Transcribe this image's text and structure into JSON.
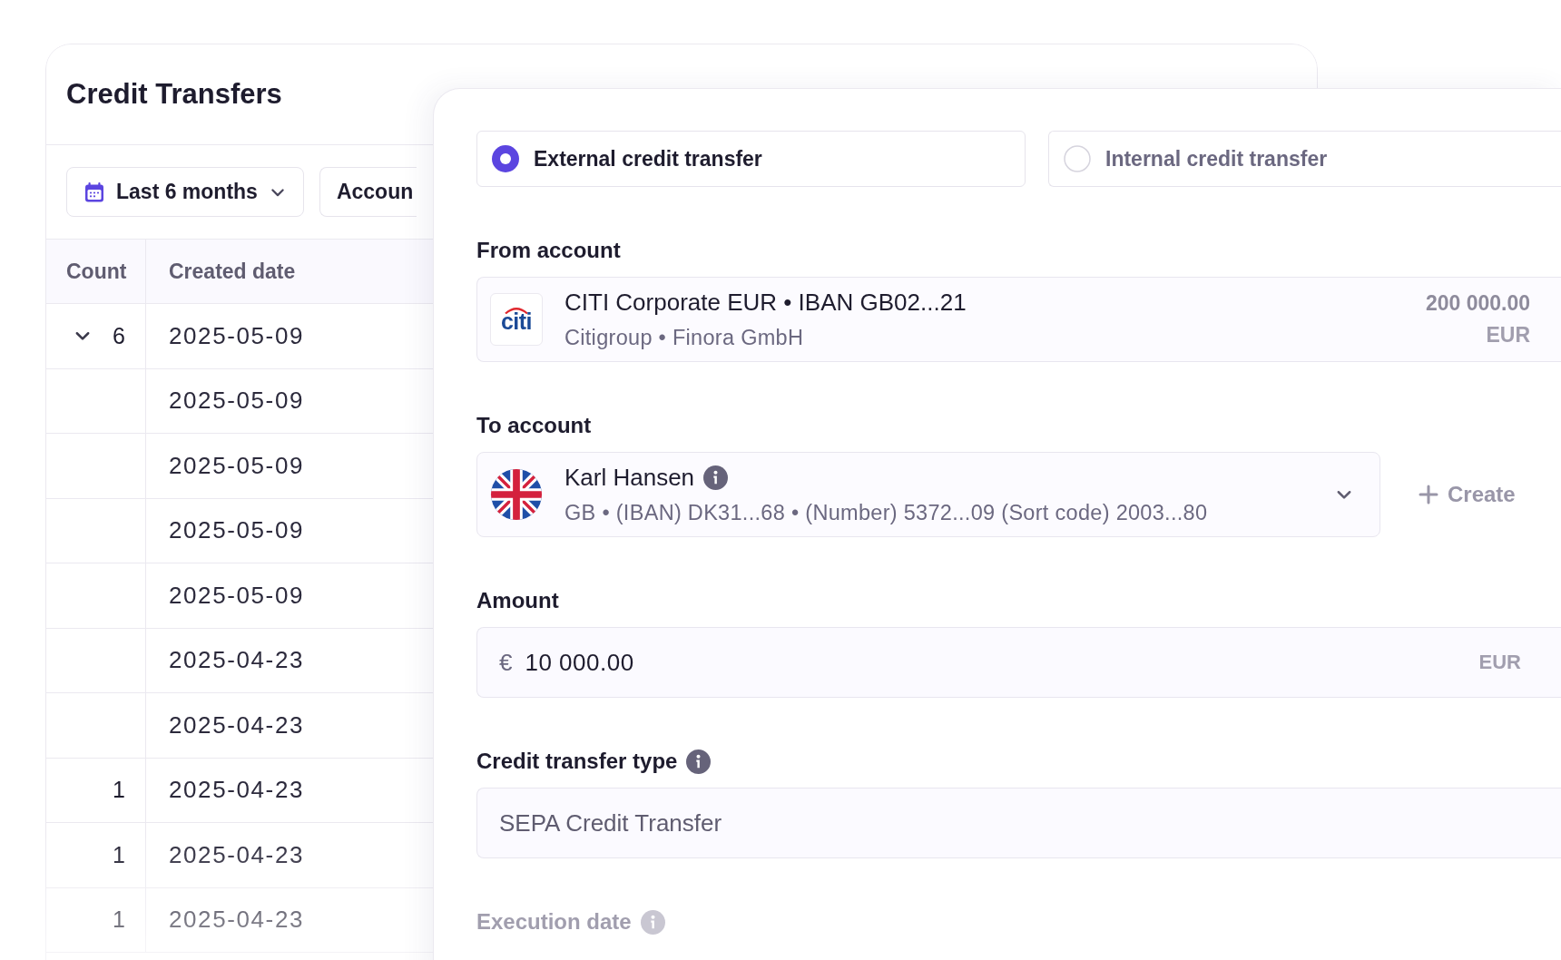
{
  "page": {
    "title": "Credit Transfers"
  },
  "filters": [
    {
      "kind": "date",
      "label": "Last 6 months"
    },
    {
      "kind": "plain",
      "label": "Accoun"
    }
  ],
  "table": {
    "columns": [
      "Count",
      "Created date"
    ],
    "rows": [
      {
        "kind": "group",
        "count": "6",
        "expanded": true,
        "date": "2025-05-09"
      },
      {
        "kind": "child",
        "date": "2025-05-09"
      },
      {
        "kind": "child",
        "date": "2025-05-09"
      },
      {
        "kind": "child",
        "date": "2025-05-09"
      },
      {
        "kind": "child",
        "date": "2025-05-09"
      },
      {
        "kind": "child",
        "date": "2025-04-23"
      },
      {
        "kind": "child",
        "date": "2025-04-23"
      },
      {
        "kind": "single",
        "count": "1",
        "date": "2025-04-23"
      },
      {
        "kind": "single",
        "count": "1",
        "date": "2025-04-23"
      },
      {
        "kind": "single",
        "count": "1",
        "date": "2025-04-23"
      }
    ]
  },
  "transfer_form": {
    "modes": [
      {
        "label": "External credit transfer",
        "selected": true
      },
      {
        "label": "Internal credit transfer",
        "selected": false
      }
    ],
    "from_account": {
      "label": "From account",
      "logo_text": "citi",
      "name": "CITI Corporate EUR • IBAN GB02...21",
      "details": "Citigroup • Finora GmbH",
      "balance": "200 000.00",
      "currency": "EUR"
    },
    "to_account": {
      "label": "To account",
      "name": "Karl Hansen",
      "details": "GB •  (IBAN) DK31...68 • (Number) 5372...09 (Sort code) 2003...80",
      "create_button": "Create"
    },
    "amount": {
      "label": "Amount",
      "currency_symbol": "€",
      "value": "10 000.00",
      "currency": "EUR"
    },
    "credit_transfer_type": {
      "label": "Credit transfer type",
      "value": "SEPA Credit Transfer"
    },
    "execution_date": {
      "label": "Execution date"
    }
  }
}
